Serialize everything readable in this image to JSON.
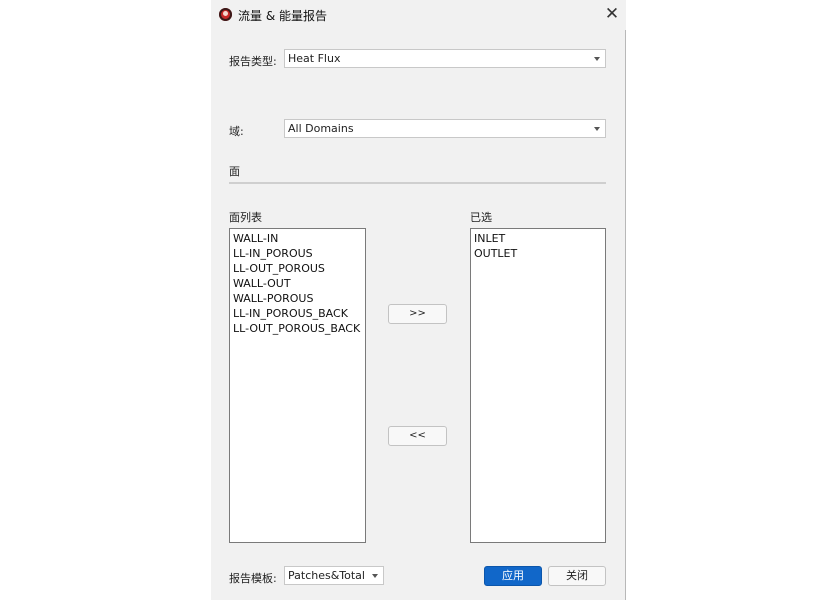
{
  "window": {
    "title": "流量 & 能量报告",
    "close_icon": "close-icon"
  },
  "report_type": {
    "label": "报告类型:",
    "value": "Heat Flux"
  },
  "domain": {
    "label": "域:",
    "value": "All Domains"
  },
  "face_section": {
    "label": "面"
  },
  "face_list": {
    "label": "面列表",
    "items": [
      "WALL-IN",
      "LL-IN_POROUS",
      "LL-OUT_POROUS",
      "WALL-OUT",
      "WALL-POROUS",
      "LL-IN_POROUS_BACK",
      "LL-OUT_POROUS_BACK"
    ]
  },
  "selected_list": {
    "label": "已选",
    "items": [
      "INLET",
      "OUTLET"
    ]
  },
  "transfer": {
    "add_label": ">>",
    "remove_label": "<<"
  },
  "report_template": {
    "label": "报告模板:",
    "value": "Patches&Total"
  },
  "actions": {
    "apply_label": "应用",
    "close_label": "关闭"
  },
  "colors": {
    "primary_button": "#1167c9",
    "dialog_bg": "#f1f1f1"
  }
}
